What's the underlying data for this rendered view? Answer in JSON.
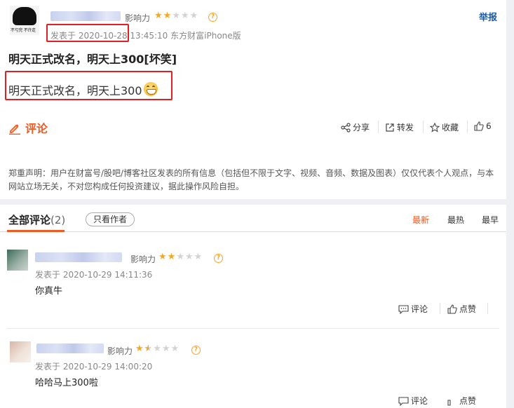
{
  "post": {
    "influence_label": "影响力",
    "star_rating": 2,
    "report_label": "举报",
    "avatar_caption": "不亏完 不许走",
    "published_prefix": "发表于",
    "published_date": "2020-10-28",
    "published_time": "13:45:10",
    "published_source": "东方财富iPhone版",
    "title": "明天正式改名，明天上300[坏笑]",
    "body": "明天正式改名，明天上300",
    "body_emoji": "grin-emoji",
    "comment_button": "评论",
    "share_label": "分享",
    "repost_label": "转发",
    "favorite_label": "收藏",
    "like_count": "6",
    "disclaimer": "郑重声明：用户在财富号/股吧/博客社区发表的所有信息（包括但不限于文字、视频、音频、数据及图表）仅仅代表个人观点，与本网站立场无关，不对您构成任何投资建议，据此操作风险自担。"
  },
  "comments_section": {
    "title": "全部评论",
    "count": "(2)",
    "author_only_label": "只看作者",
    "sort_options": [
      "最新",
      "最热",
      "最早"
    ],
    "active_sort": "最新"
  },
  "comments": [
    {
      "influence_label": "影响力",
      "star_rating": 2,
      "time": "发表于 2020-10-29 14:11:36",
      "text": "你真牛",
      "reply_label": "评论",
      "like_label": "点赞"
    },
    {
      "influence_label": "影响力",
      "star_rating": 1.5,
      "time": "发表于 2020-10-29 14:00:20",
      "text": "哈哈马上300啦",
      "reply_label": "评论",
      "like_label": "点赞"
    }
  ],
  "colors": {
    "accent": "#f15a22",
    "link": "#1a5aa6",
    "star": "#f5a623",
    "highlight_box": "#e02020"
  }
}
